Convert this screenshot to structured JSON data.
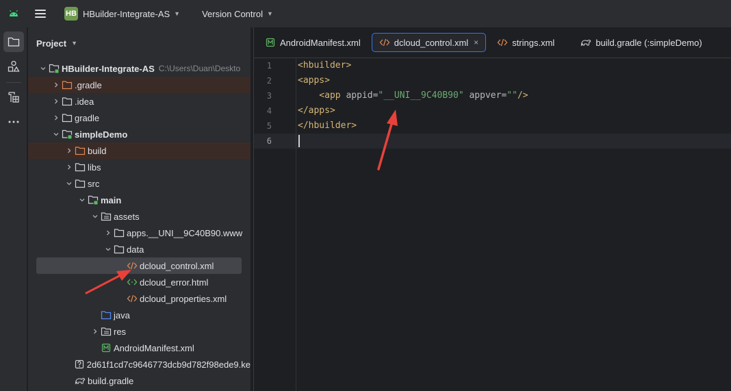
{
  "topbar": {
    "project_badge": "HB",
    "project_name": "HBuilder-Integrate-AS",
    "vcs_label": "Version Control"
  },
  "panel": {
    "title": "Project"
  },
  "tree": [
    {
      "label": "HBuilder-Integrate-AS",
      "path": "C:\\Users\\Duan\\Deskto",
      "indent": 0,
      "arrow": "down",
      "icon": "module-folder-icon",
      "bold": true
    },
    {
      "label": ".gradle",
      "indent": 1,
      "arrow": "right",
      "icon": "excluded-folder-icon",
      "excluded": true
    },
    {
      "label": ".idea",
      "indent": 1,
      "arrow": "right",
      "icon": "folder-icon"
    },
    {
      "label": "gradle",
      "indent": 1,
      "arrow": "right",
      "icon": "folder-icon"
    },
    {
      "label": "simpleDemo",
      "indent": 1,
      "arrow": "down",
      "icon": "module-folder-icon",
      "bold": true
    },
    {
      "label": "build",
      "indent": 2,
      "arrow": "right",
      "icon": "excluded-folder-icon",
      "excluded": true
    },
    {
      "label": "libs",
      "indent": 2,
      "arrow": "right",
      "icon": "folder-icon"
    },
    {
      "label": "src",
      "indent": 2,
      "arrow": "down",
      "icon": "folder-icon"
    },
    {
      "label": "main",
      "indent": 3,
      "arrow": "down",
      "icon": "module-folder-icon",
      "bold": true
    },
    {
      "label": "assets",
      "indent": 4,
      "arrow": "down",
      "icon": "resource-folder-icon"
    },
    {
      "label": "apps.__UNI__9C40B90.www",
      "indent": 5,
      "arrow": "right",
      "icon": "folder-icon"
    },
    {
      "label": "data",
      "indent": 5,
      "arrow": "down",
      "icon": "folder-icon"
    },
    {
      "label": "dcloud_control.xml",
      "indent": 6,
      "arrow": "",
      "icon": "xml-file-icon",
      "selected": true
    },
    {
      "label": "dcloud_error.html",
      "indent": 6,
      "arrow": "",
      "icon": "html-file-icon"
    },
    {
      "label": "dcloud_properties.xml",
      "indent": 6,
      "arrow": "",
      "icon": "xml-file-icon"
    },
    {
      "label": "java",
      "indent": 4,
      "arrow": "",
      "icon": "source-folder-icon"
    },
    {
      "label": "res",
      "indent": 4,
      "arrow": "right",
      "icon": "resource-folder-icon"
    },
    {
      "label": "AndroidManifest.xml",
      "indent": 4,
      "arrow": "",
      "icon": "manifest-file-icon"
    },
    {
      "label": "2d61f1cd7c9646773dcb9d782f98ede9.ke",
      "indent": 2,
      "arrow": "",
      "icon": "unknown-file-icon"
    },
    {
      "label": "build.gradle",
      "indent": 2,
      "arrow": "",
      "icon": "gradle-file-icon"
    }
  ],
  "tabs": [
    {
      "label": "AndroidManifest.xml",
      "icon": "manifest-file-icon",
      "active": false
    },
    {
      "label": "dcloud_control.xml",
      "icon": "xml-file-icon",
      "active": true
    },
    {
      "label": "strings.xml",
      "icon": "xml-file-icon",
      "active": false
    },
    {
      "label": "build.gradle (:simpleDemo)",
      "icon": "gradle-file-icon",
      "active": false
    }
  ],
  "tab_close_glyph": "×",
  "editor": {
    "line_numbers": [
      "1",
      "2",
      "3",
      "4",
      "5",
      "6"
    ],
    "current_line": "6",
    "code_lines": [
      [
        {
          "t": "<hbuilder>",
          "c": "tag"
        }
      ],
      [
        {
          "t": "<apps>",
          "c": "tag"
        }
      ],
      [
        {
          "t": "    <app ",
          "c": "tag"
        },
        {
          "t": "appid",
          "c": "attr"
        },
        {
          "t": "=",
          "c": "eq"
        },
        {
          "t": "\"__UNI__9C40B90\"",
          "c": "str"
        },
        {
          "t": " appver",
          "c": "attr"
        },
        {
          "t": "=",
          "c": "eq"
        },
        {
          "t": "\"\"",
          "c": "str"
        },
        {
          "t": "/>",
          "c": "tag"
        }
      ],
      [
        {
          "t": "</apps>",
          "c": "tag"
        }
      ],
      [
        {
          "t": "</hbuilder>",
          "c": "tag"
        }
      ],
      []
    ]
  },
  "colors": {
    "accent": "#3574f0",
    "annotation_arrow": "#e8413a",
    "module_badge": "#6e9b4f"
  }
}
